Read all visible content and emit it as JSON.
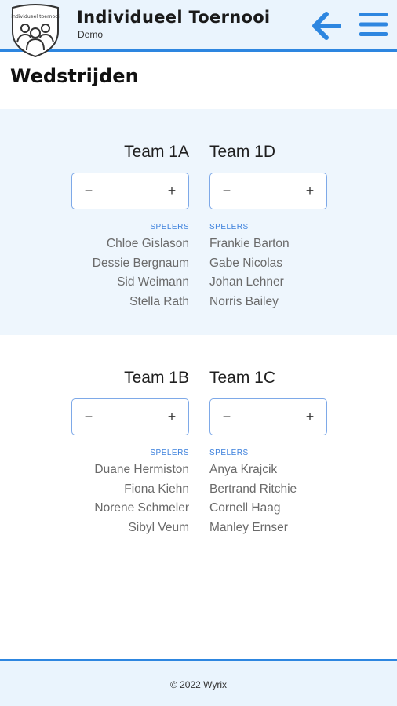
{
  "header": {
    "title": "Individueel Toernooi",
    "subtitle": "Demo",
    "logo_text": "individueel toernooi",
    "back_icon": "arrow-left-icon",
    "menu_icon": "hamburger-menu-icon",
    "accent_color": "#2d86e0"
  },
  "page": {
    "title": "Wedstrijden"
  },
  "matches": [
    {
      "home": {
        "name": "Team 1A",
        "players_label": "SPELERS",
        "players": [
          "Chloe Gislason",
          "Dessie Bergnaum",
          "Sid Weimann",
          "Stella Rath"
        ]
      },
      "away": {
        "name": "Team 1D",
        "players_label": "SPELERS",
        "players": [
          "Frankie Barton",
          "Gabe Nicolas",
          "Johan Lehner",
          "Norris Bailey"
        ]
      }
    },
    {
      "home": {
        "name": "Team 1B",
        "players_label": "SPELERS",
        "players": [
          "Duane Hermiston",
          "Fiona Kiehn",
          "Norene Schmeler",
          "Sibyl Veum"
        ]
      },
      "away": {
        "name": "Team 1C",
        "players_label": "SPELERS",
        "players": [
          "Anya Krajcik",
          "Bertrand Ritchie",
          "Cornell Haag",
          "Manley Ernser"
        ]
      }
    }
  ],
  "stepper": {
    "minus": "−",
    "plus": "+"
  },
  "footer": {
    "text": "© 2022 Wyrix"
  }
}
